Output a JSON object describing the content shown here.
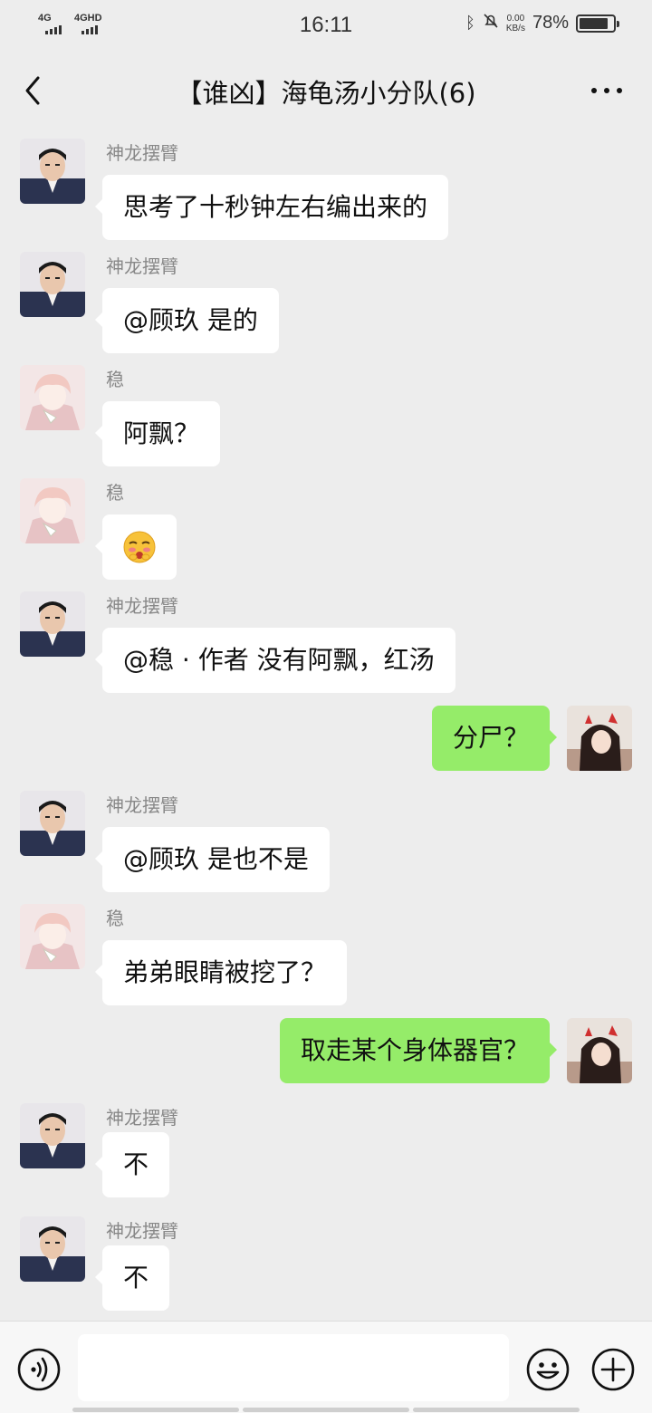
{
  "status": {
    "signal1": "4G",
    "signal2": "4GHD",
    "time": "16:11",
    "net_speed_value": "0.00",
    "net_speed_unit": "KB/s",
    "battery": "78%"
  },
  "header": {
    "title": "【谁凶】海龟汤小分队(6)"
  },
  "messages": [
    {
      "side": "in",
      "sender": "神龙摆臂",
      "text": "思考了十秒钟左右编出来的",
      "avatar": "man-avatar"
    },
    {
      "side": "in",
      "sender": "神龙摆臂",
      "text": "@顾玖  是的",
      "avatar": "man-avatar"
    },
    {
      "side": "in",
      "sender": "稳",
      "text": "阿飘？",
      "avatar": "anime-avatar"
    },
    {
      "side": "in",
      "sender": "稳",
      "text": "",
      "emoji": "blushing-emoji",
      "avatar": "anime-avatar"
    },
    {
      "side": "in",
      "sender": "神龙摆臂",
      "text": "@稳 · 作者  没有阿飘，红汤",
      "avatar": "man-avatar"
    },
    {
      "side": "out",
      "text": "分尸？",
      "avatar": "girl-avatar"
    },
    {
      "side": "in",
      "sender": "神龙摆臂",
      "text": "@顾玖  是也不是",
      "avatar": "man-avatar"
    },
    {
      "side": "in",
      "sender": "稳",
      "text": "弟弟眼睛被挖了？",
      "avatar": "anime-avatar"
    },
    {
      "side": "out",
      "text": "取走某个身体器官？",
      "avatar": "girl-avatar"
    },
    {
      "side": "in",
      "sender": "神龙摆臂",
      "text": "不",
      "avatar": "man-avatar"
    },
    {
      "side": "in",
      "sender": "神龙摆臂",
      "text": "不",
      "avatar": "man-avatar"
    }
  ],
  "input": {
    "value": ""
  },
  "colors": {
    "background": "#ededed",
    "incoming_bubble": "#ffffff",
    "outgoing_bubble": "#95ec69",
    "sender_name": "#888888"
  }
}
